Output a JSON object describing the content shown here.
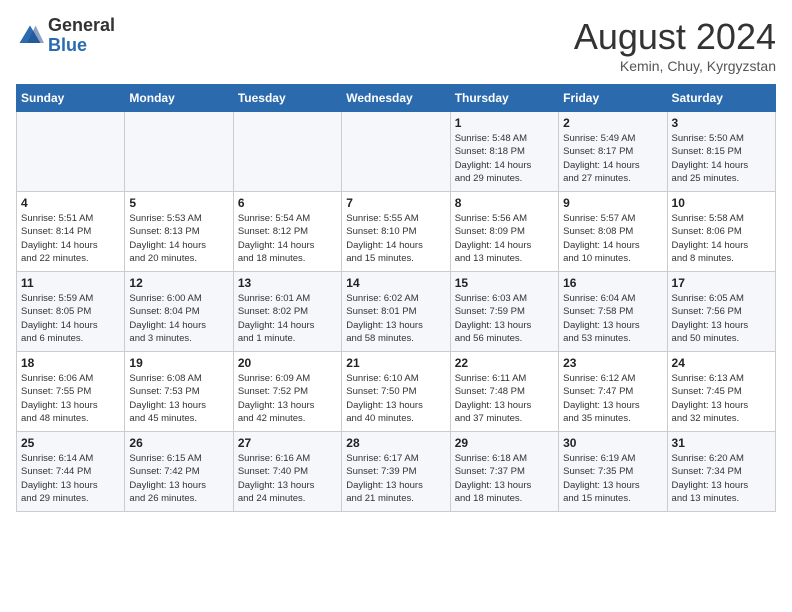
{
  "header": {
    "logo_line1": "General",
    "logo_line2": "Blue",
    "month": "August 2024",
    "location": "Kemin, Chuy, Kyrgyzstan"
  },
  "weekdays": [
    "Sunday",
    "Monday",
    "Tuesday",
    "Wednesday",
    "Thursday",
    "Friday",
    "Saturday"
  ],
  "weeks": [
    [
      {
        "day": "",
        "detail": ""
      },
      {
        "day": "",
        "detail": ""
      },
      {
        "day": "",
        "detail": ""
      },
      {
        "day": "",
        "detail": ""
      },
      {
        "day": "1",
        "detail": "Sunrise: 5:48 AM\nSunset: 8:18 PM\nDaylight: 14 hours\nand 29 minutes."
      },
      {
        "day": "2",
        "detail": "Sunrise: 5:49 AM\nSunset: 8:17 PM\nDaylight: 14 hours\nand 27 minutes."
      },
      {
        "day": "3",
        "detail": "Sunrise: 5:50 AM\nSunset: 8:15 PM\nDaylight: 14 hours\nand 25 minutes."
      }
    ],
    [
      {
        "day": "4",
        "detail": "Sunrise: 5:51 AM\nSunset: 8:14 PM\nDaylight: 14 hours\nand 22 minutes."
      },
      {
        "day": "5",
        "detail": "Sunrise: 5:53 AM\nSunset: 8:13 PM\nDaylight: 14 hours\nand 20 minutes."
      },
      {
        "day": "6",
        "detail": "Sunrise: 5:54 AM\nSunset: 8:12 PM\nDaylight: 14 hours\nand 18 minutes."
      },
      {
        "day": "7",
        "detail": "Sunrise: 5:55 AM\nSunset: 8:10 PM\nDaylight: 14 hours\nand 15 minutes."
      },
      {
        "day": "8",
        "detail": "Sunrise: 5:56 AM\nSunset: 8:09 PM\nDaylight: 14 hours\nand 13 minutes."
      },
      {
        "day": "9",
        "detail": "Sunrise: 5:57 AM\nSunset: 8:08 PM\nDaylight: 14 hours\nand 10 minutes."
      },
      {
        "day": "10",
        "detail": "Sunrise: 5:58 AM\nSunset: 8:06 PM\nDaylight: 14 hours\nand 8 minutes."
      }
    ],
    [
      {
        "day": "11",
        "detail": "Sunrise: 5:59 AM\nSunset: 8:05 PM\nDaylight: 14 hours\nand 6 minutes."
      },
      {
        "day": "12",
        "detail": "Sunrise: 6:00 AM\nSunset: 8:04 PM\nDaylight: 14 hours\nand 3 minutes."
      },
      {
        "day": "13",
        "detail": "Sunrise: 6:01 AM\nSunset: 8:02 PM\nDaylight: 14 hours\nand 1 minute."
      },
      {
        "day": "14",
        "detail": "Sunrise: 6:02 AM\nSunset: 8:01 PM\nDaylight: 13 hours\nand 58 minutes."
      },
      {
        "day": "15",
        "detail": "Sunrise: 6:03 AM\nSunset: 7:59 PM\nDaylight: 13 hours\nand 56 minutes."
      },
      {
        "day": "16",
        "detail": "Sunrise: 6:04 AM\nSunset: 7:58 PM\nDaylight: 13 hours\nand 53 minutes."
      },
      {
        "day": "17",
        "detail": "Sunrise: 6:05 AM\nSunset: 7:56 PM\nDaylight: 13 hours\nand 50 minutes."
      }
    ],
    [
      {
        "day": "18",
        "detail": "Sunrise: 6:06 AM\nSunset: 7:55 PM\nDaylight: 13 hours\nand 48 minutes."
      },
      {
        "day": "19",
        "detail": "Sunrise: 6:08 AM\nSunset: 7:53 PM\nDaylight: 13 hours\nand 45 minutes."
      },
      {
        "day": "20",
        "detail": "Sunrise: 6:09 AM\nSunset: 7:52 PM\nDaylight: 13 hours\nand 42 minutes."
      },
      {
        "day": "21",
        "detail": "Sunrise: 6:10 AM\nSunset: 7:50 PM\nDaylight: 13 hours\nand 40 minutes."
      },
      {
        "day": "22",
        "detail": "Sunrise: 6:11 AM\nSunset: 7:48 PM\nDaylight: 13 hours\nand 37 minutes."
      },
      {
        "day": "23",
        "detail": "Sunrise: 6:12 AM\nSunset: 7:47 PM\nDaylight: 13 hours\nand 35 minutes."
      },
      {
        "day": "24",
        "detail": "Sunrise: 6:13 AM\nSunset: 7:45 PM\nDaylight: 13 hours\nand 32 minutes."
      }
    ],
    [
      {
        "day": "25",
        "detail": "Sunrise: 6:14 AM\nSunset: 7:44 PM\nDaylight: 13 hours\nand 29 minutes."
      },
      {
        "day": "26",
        "detail": "Sunrise: 6:15 AM\nSunset: 7:42 PM\nDaylight: 13 hours\nand 26 minutes."
      },
      {
        "day": "27",
        "detail": "Sunrise: 6:16 AM\nSunset: 7:40 PM\nDaylight: 13 hours\nand 24 minutes."
      },
      {
        "day": "28",
        "detail": "Sunrise: 6:17 AM\nSunset: 7:39 PM\nDaylight: 13 hours\nand 21 minutes."
      },
      {
        "day": "29",
        "detail": "Sunrise: 6:18 AM\nSunset: 7:37 PM\nDaylight: 13 hours\nand 18 minutes."
      },
      {
        "day": "30",
        "detail": "Sunrise: 6:19 AM\nSunset: 7:35 PM\nDaylight: 13 hours\nand 15 minutes."
      },
      {
        "day": "31",
        "detail": "Sunrise: 6:20 AM\nSunset: 7:34 PM\nDaylight: 13 hours\nand 13 minutes."
      }
    ]
  ]
}
